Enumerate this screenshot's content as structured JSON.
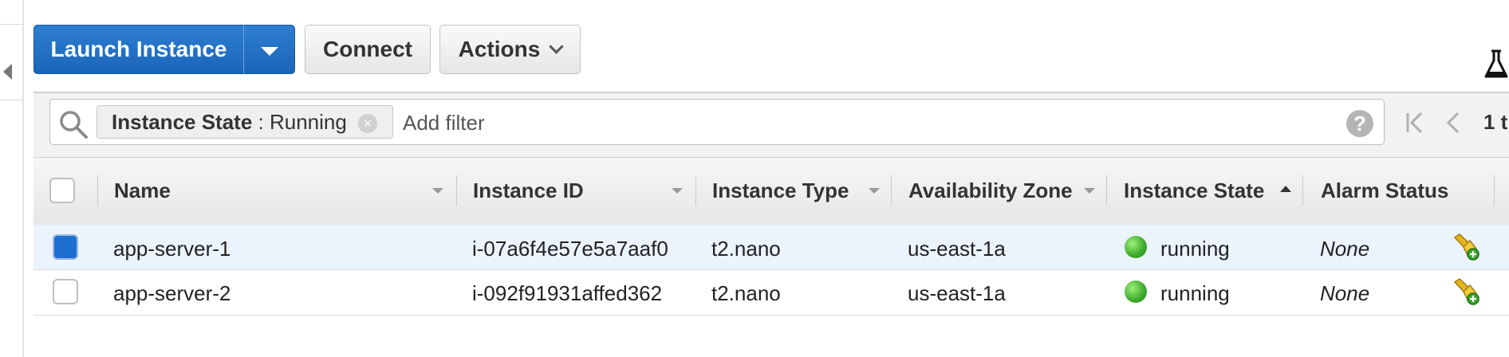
{
  "toolbar": {
    "launch_label": "Launch Instance",
    "connect_label": "Connect",
    "actions_label": "Actions"
  },
  "filter": {
    "chip_key": "Instance State",
    "chip_sep": " : ",
    "chip_value": "Running",
    "placeholder": "Add filter"
  },
  "pagination": {
    "text": "1 t"
  },
  "table": {
    "columns": [
      "Name",
      "Instance ID",
      "Instance Type",
      "Availability Zone",
      "Instance State",
      "Alarm Status"
    ],
    "rows": [
      {
        "name": "app-server-1",
        "id": "i-07a6f4e57e5a7aaf0",
        "type": "t2.nano",
        "zone": "us-east-1a",
        "state": "running",
        "alarm": "None",
        "selected": true
      },
      {
        "name": "app-server-2",
        "id": "i-092f91931affed362",
        "type": "t2.nano",
        "zone": "us-east-1a",
        "state": "running",
        "alarm": "None",
        "selected": false
      }
    ]
  },
  "colors": {
    "primary": "#1b65b8",
    "running": "#3aa82a",
    "selected_row": "#ebf3fc"
  },
  "icons": [
    "collapse-arrow-icon",
    "caret-down-icon",
    "chevron-down-icon",
    "flask-icon",
    "search-icon",
    "clear-icon",
    "help-icon",
    "first-page-icon",
    "prev-page-icon",
    "status-dot-icon",
    "alarm-add-icon"
  ]
}
